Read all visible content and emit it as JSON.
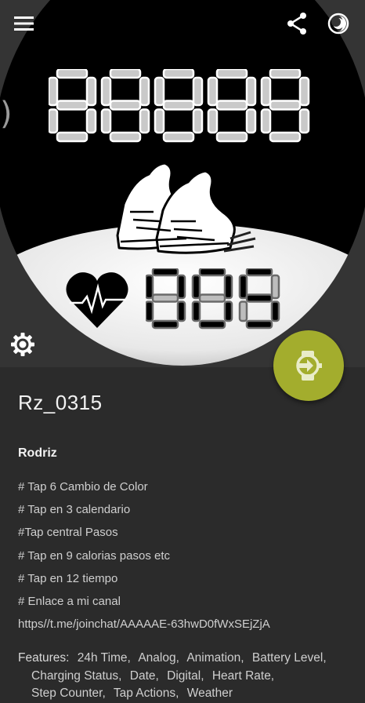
{
  "header": {
    "menu_icon": "hamburger-menu-icon",
    "share_icon": "share-icon",
    "theme_icon": "half-moon-toggle-icon"
  },
  "watch_face": {
    "steps_display": "00000",
    "heart_rate_display": "005",
    "graphic": "sneakers-icon",
    "heart_icon": "heart-pulse-icon",
    "side_mark": ")"
  },
  "actions": {
    "settings_icon": "gear-icon",
    "install_icon": "watch-send-icon",
    "fab_color": "#a3ad2d"
  },
  "details": {
    "title": "Rz_0315",
    "author": "Rodriz",
    "description": [
      "# Tap 6 Cambio de Color",
      "# Tap en 3 calendario",
      "#Tap central Pasos",
      "# Tap en 9 calorias pasos etc",
      "# Tap en 12 tiempo",
      "# Enlace a mi canal",
      "https//t.me/joinchat/AAAAAE-63hwD0fWxSEjZjA"
    ],
    "features_label": "Features:",
    "features": [
      "24h Time,",
      "Analog,",
      "Animation,",
      "Battery Level,",
      "Charging Status,",
      "Date,",
      "Digital,",
      "Heart Rate,",
      "Step Counter,",
      "Tap Actions,",
      "Weather"
    ]
  }
}
